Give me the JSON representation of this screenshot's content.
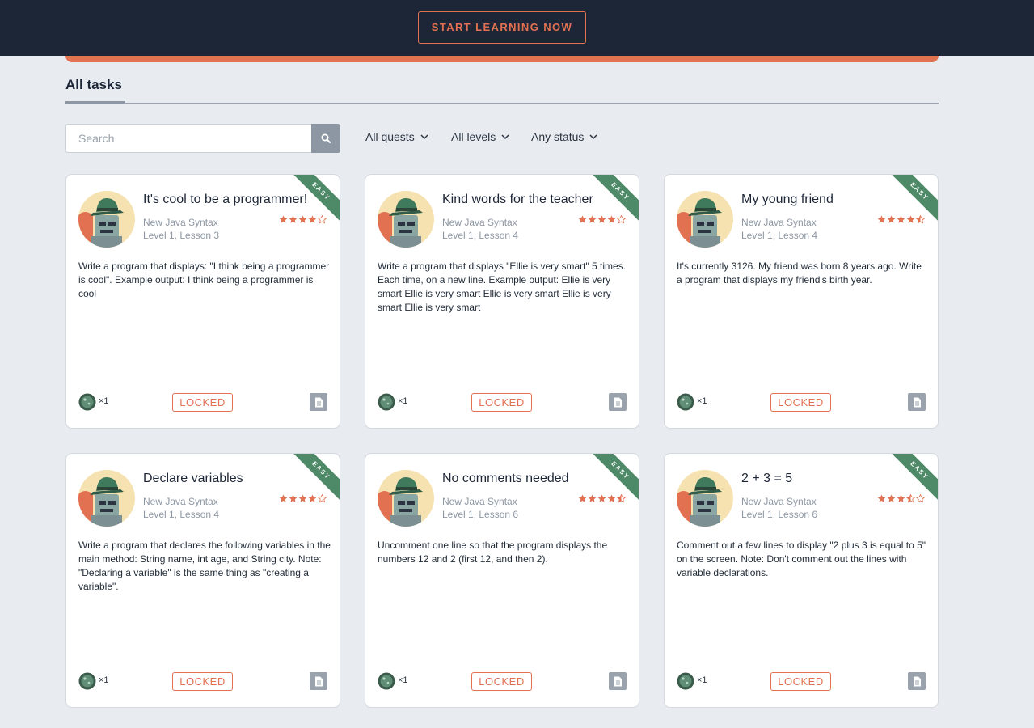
{
  "header": {
    "cta_label": "START LEARNING NOW"
  },
  "tabs": {
    "active_label": "All tasks"
  },
  "search": {
    "placeholder": "Search",
    "value": ""
  },
  "filters": [
    {
      "label": "All quests"
    },
    {
      "label": "All levels"
    },
    {
      "label": "Any status"
    }
  ],
  "colors": {
    "accent": "#e27152",
    "header_bg": "#1d2637",
    "ribbon": "#4e8a67",
    "page_bg": "#e8ecf1"
  },
  "cards": [
    {
      "title": "It's cool to be a programmer!",
      "quest": "New Java Syntax",
      "lesson": "Level 1, Lesson 3",
      "rating": 4,
      "difficulty": "EASY",
      "description": "Write a program that displays: \"I think being a programmer is cool\". Example output: I think being a programmer is cool",
      "reward": "×1",
      "status": "LOCKED"
    },
    {
      "title": "Kind words for the teacher",
      "quest": "New Java Syntax",
      "lesson": "Level 1, Lesson 4",
      "rating": 4,
      "difficulty": "EASY",
      "description": "Write a program that displays \"Ellie is very smart\" 5 times. Each time, on a new line. Example output: Ellie is very smart Ellie is very smart Ellie is very smart Ellie is very smart Ellie is very smart",
      "reward": "×1",
      "status": "LOCKED"
    },
    {
      "title": "My young friend",
      "quest": "New Java Syntax",
      "lesson": "Level 1, Lesson 4",
      "rating": 4.5,
      "difficulty": "EASY",
      "description": "It's currently 3126. My friend was born 8 years ago. Write a program that displays my friend's birth year.",
      "reward": "×1",
      "status": "LOCKED"
    },
    {
      "title": "Declare variables",
      "quest": "New Java Syntax",
      "lesson": "Level 1, Lesson 4",
      "rating": 4,
      "difficulty": "EASY",
      "description": "Write a program that declares the following variables in the main method: String name, int age, and String city. Note: \"Declaring a variable\" is the same thing as \"creating a variable\".",
      "reward": "×1",
      "status": "LOCKED"
    },
    {
      "title": "No comments needed",
      "quest": "New Java Syntax",
      "lesson": "Level 1, Lesson 6",
      "rating": 4.5,
      "difficulty": "EASY",
      "description": "Uncomment one line so that the program displays the numbers 12 and 2 (first 12, and then 2).",
      "reward": "×1",
      "status": "LOCKED"
    },
    {
      "title": "2 + 3 = 5",
      "quest": "New Java Syntax",
      "lesson": "Level 1, Lesson 6",
      "rating": 3.5,
      "difficulty": "EASY",
      "description": "Comment out a few lines to display \"2 plus 3 is equal to 5\" on the screen. Note: Don't comment out the lines with variable declarations.",
      "reward": "×1",
      "status": "LOCKED"
    }
  ]
}
